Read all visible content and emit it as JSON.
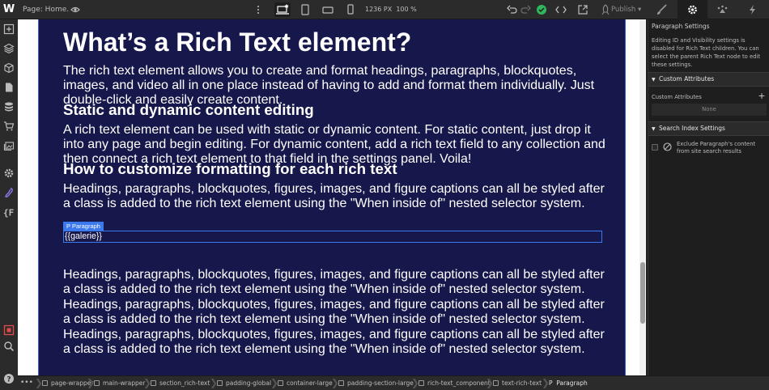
{
  "topbar": {
    "logo": "W",
    "page_label": "Page: Home.",
    "width_px": "1236 PX",
    "zoom": "100 %",
    "publish_label": "Publish"
  },
  "colors": {
    "canvas_bg": "#16174a",
    "selection": "#3b79ec",
    "status_ok": "#2fb75e",
    "ui_dark": "#2b2b2b",
    "panel_bg": "#1e1e1e"
  },
  "icons": {
    "left_toolbar": [
      "add-panel-icon",
      "navigator-icon",
      "components-icon",
      "pages-icon",
      "cms-icon",
      "ecommerce-icon",
      "assets-icon",
      "settings-icon",
      "brand-icon",
      "variables-icon",
      "audit-icon",
      "search-icon",
      "help-icon"
    ],
    "panel_tabs": [
      "style-brush-icon",
      "settings-gear-icon",
      "interactions-icon",
      "lightning-icon"
    ]
  },
  "content": {
    "h1": "What’s a Rich Text element?",
    "p1": "The rich text element allows you to create and format headings, paragraphs, blockquotes, images, and video all in one place instead of having to add and format them individually. Just double-click and easily create content.",
    "h2": "Static and dynamic content editing",
    "p2": "A rich text element can be used with static or dynamic content. For static content, just drop it into any page and begin editing. For dynamic content, add a rich text field to any collection and then connect a rich text element to that field in the settings panel. Voila!",
    "h3": "How to customize formatting for each rich text",
    "p3": "Headings, paragraphs, blockquotes, figures, images, and figure captions can all be styled after a class is added to the rich text element using the \"When inside of\" nested selector system.",
    "selected_tag": "P  Paragraph",
    "selected_text": "{{galerie}}",
    "p4": "Headings, paragraphs, blockquotes, figures, images, and figure captions can all be styled after a class is added to the rich text element using the \"When inside of\" nested selector system.",
    "p5": "Headings, paragraphs, blockquotes, figures, images, and figure captions can all be styled after a class is added to the rich text element using the \"When inside of\" nested selector system.",
    "p6": "Headings, paragraphs, blockquotes, figures, images, and figure captions can all be styled after a class is added to the rich text element using the \"When inside of\" nested selector system."
  },
  "right_panel": {
    "title": "Paragraph Settings",
    "notice": "Editing ID and Visibility settings is disabled for Rich Text children. You can select the parent Rich Text node to edit these settings.",
    "custom_attributes_section": "Custom Attributes",
    "custom_attributes_label": "Custom Attributes",
    "none_label": "None",
    "search_index_section": "Search Index Settings",
    "exclude_label": "Exclude Paragraph's content from site search results"
  },
  "breadcrumbs": {
    "more": "•••",
    "items": [
      "page-wrapper",
      "main-wrapper",
      "section_rich-text",
      "padding-global",
      "container-large",
      "padding-section-large",
      "rich-text_component",
      "text-rich-text",
      "Paragraph"
    ]
  }
}
